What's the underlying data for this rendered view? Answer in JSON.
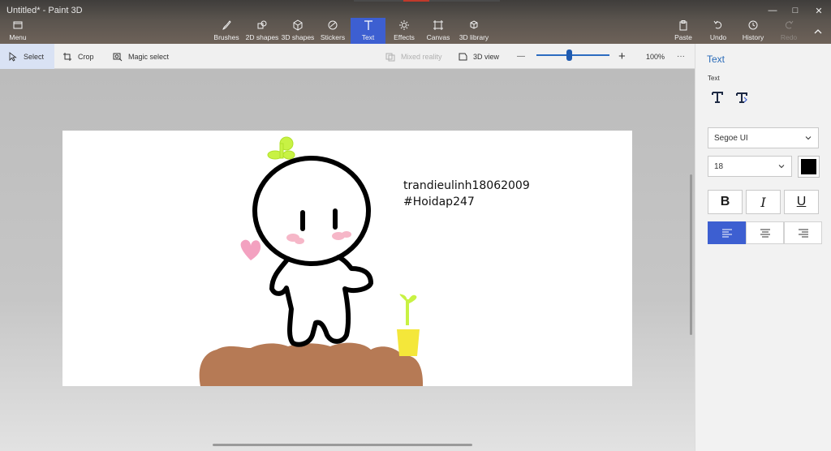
{
  "window": {
    "title": "Untitled* - Paint 3D",
    "controls": {
      "minimize": "—",
      "maximize": "□",
      "close": "✕"
    }
  },
  "toolbar": {
    "menu_label": "Menu",
    "tools": [
      {
        "label": "Brushes",
        "icon": "brush-icon"
      },
      {
        "label": "2D shapes",
        "icon": "shapes-2d-icon"
      },
      {
        "label": "3D shapes",
        "icon": "cube-icon"
      },
      {
        "label": "Stickers",
        "icon": "sticker-icon"
      },
      {
        "label": "Text",
        "icon": "text-icon",
        "active": true
      },
      {
        "label": "Effects",
        "icon": "sun-icon"
      },
      {
        "label": "Canvas",
        "icon": "canvas-icon"
      },
      {
        "label": "3D library",
        "icon": "library-icon"
      }
    ],
    "paste_label": "Paste",
    "undo_label": "Undo",
    "history_label": "History",
    "redo_label": "Redo"
  },
  "subtoolbar": {
    "select_label": "Select",
    "crop_label": "Crop",
    "magic_select_label": "Magic select",
    "mixed_reality_label": "Mixed reality",
    "view_3d_label": "3D view",
    "zoom_out_symbol": "—",
    "zoom_in_symbol": "+",
    "zoom_level": "100%",
    "zoom_fraction": 0.45,
    "more_symbol": "···"
  },
  "canvas": {
    "text_lines": [
      "trandieulinh18062009",
      "#Hoidap247"
    ]
  },
  "panel": {
    "title": "Text",
    "subtitle": "Text",
    "font_family": "Segoe UI",
    "font_size": "18",
    "color": "#000000",
    "bold_label": "B",
    "italic_label": "I",
    "underline_label": "U",
    "alignment": "left"
  },
  "colors": {
    "accent": "#3d5fd1",
    "link_blue": "#2a6bb8",
    "soil": "#b67a55",
    "sprout": "#c8f244",
    "pot": "#f4e73a",
    "blush": "#f6b7c8",
    "heart": "#f3a1c0"
  }
}
